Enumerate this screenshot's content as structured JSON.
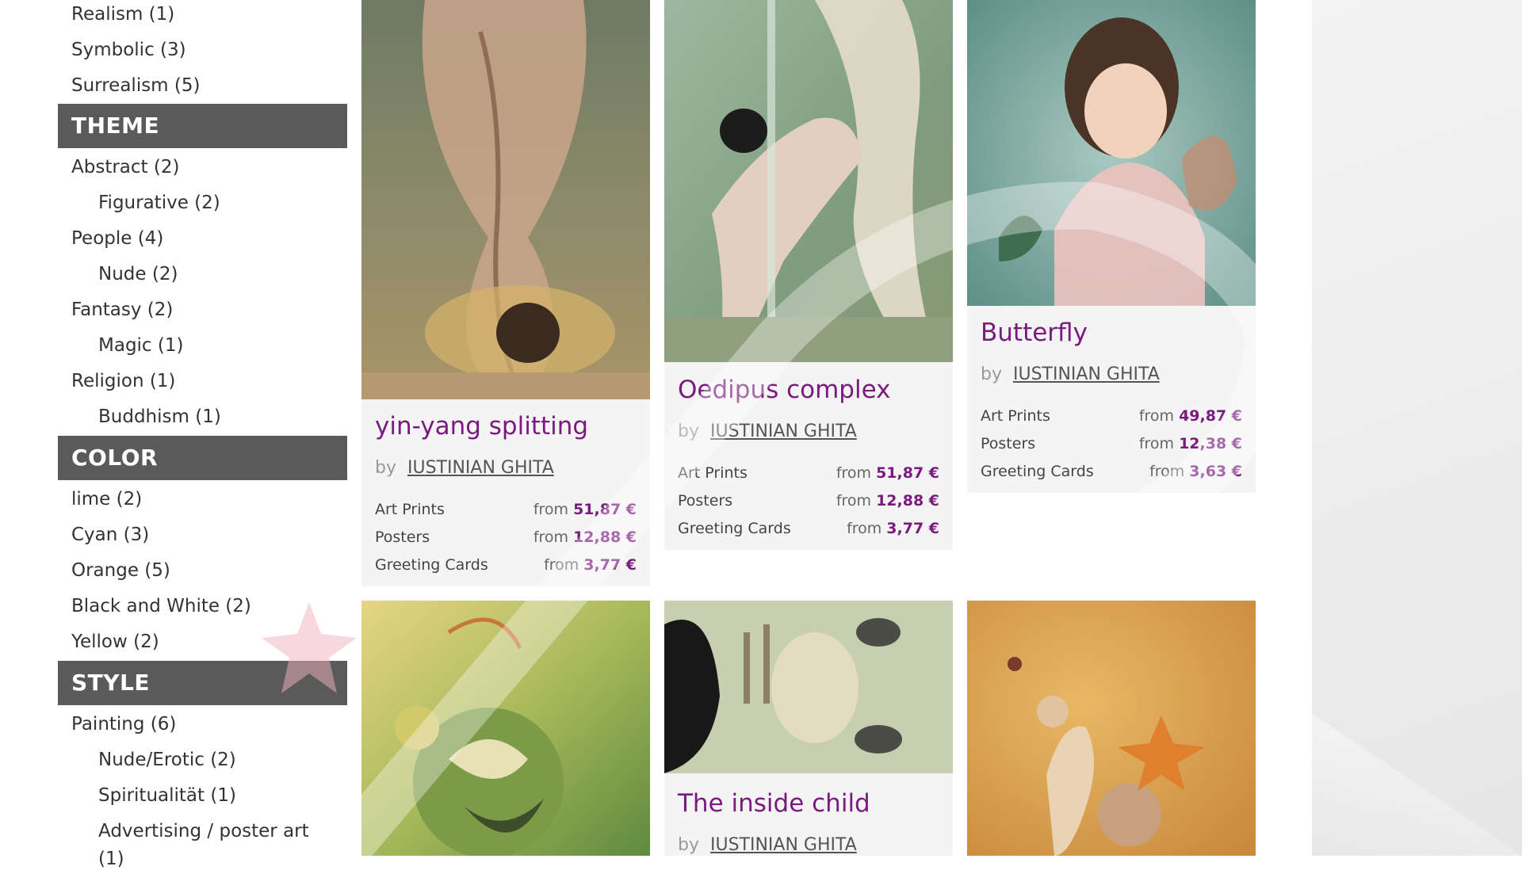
{
  "sidebar": {
    "items_top": [
      {
        "label": "Realism (1)"
      },
      {
        "label": "Symbolic (3)"
      },
      {
        "label": "Surrealism (5)"
      }
    ],
    "theme": {
      "header": "THEME",
      "items": [
        {
          "label": "Abstract (2)"
        },
        {
          "label": "Figurative (2)"
        },
        {
          "label": "People (4)"
        },
        {
          "label": "Nude (2)"
        },
        {
          "label": "Fantasy (2)"
        },
        {
          "label": "Magic (1)"
        },
        {
          "label": "Religion (1)"
        },
        {
          "label": "Buddhism (1)"
        }
      ]
    },
    "color": {
      "header": "COLOR",
      "items": [
        {
          "label": "lime (2)"
        },
        {
          "label": "Cyan (3)"
        },
        {
          "label": "Orange (5)"
        },
        {
          "label": "Black and White (2)"
        },
        {
          "label": "Yellow (2)"
        }
      ]
    },
    "style": {
      "header": "STYLE",
      "items": [
        {
          "label": "Painting (6)"
        },
        {
          "label": "Nude/Erotic (2)"
        },
        {
          "label": "Spiritualität (1)"
        },
        {
          "label": "Advertising / poster art"
        },
        {
          "label": "(1)"
        }
      ]
    }
  },
  "cards": [
    {
      "title": "yin-yang splitting",
      "by": "by",
      "artist": "IUSTINIAN GHITA",
      "prices": [
        {
          "label": "Art Prints",
          "from": "from",
          "value": "51,87 €"
        },
        {
          "label": "Posters",
          "from": "from",
          "value": "12,88 €"
        },
        {
          "label": "Greeting Cards",
          "from": "from",
          "value": "3,77 €"
        }
      ]
    },
    {
      "title": "Oedipus complex",
      "by": "by",
      "artist": "IUSTINIAN GHITA",
      "prices": [
        {
          "label": "Art Prints",
          "from": "from",
          "value": "51,87 €"
        },
        {
          "label": "Posters",
          "from": "from",
          "value": "12,88 €"
        },
        {
          "label": "Greeting Cards",
          "from": "from",
          "value": "3,77 €"
        }
      ]
    },
    {
      "title": "Butterfly",
      "by": "by",
      "artist": "IUSTINIAN GHITA",
      "prices": [
        {
          "label": "Art Prints",
          "from": "from",
          "value": "49,87 €"
        },
        {
          "label": "Posters",
          "from": "from",
          "value": "12,38 €"
        },
        {
          "label": "Greeting Cards",
          "from": "from",
          "value": "3,63 €"
        }
      ]
    },
    {
      "title": "The inside child",
      "by": "by",
      "artist": "IUSTINIAN GHITA"
    }
  ],
  "colors": {
    "accent": "#7a1a7e",
    "header_bg": "#5a5a5a",
    "card_bg": "#f4f4f4"
  }
}
